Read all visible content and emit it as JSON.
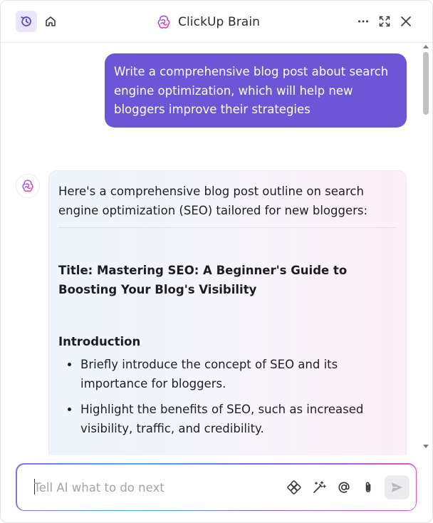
{
  "header": {
    "title": "ClickUp Brain",
    "icons": [
      "history-icon",
      "home-icon",
      "brain-logo-icon",
      "more-icon",
      "expand-icon",
      "close-icon"
    ],
    "accent": "#6c55d6"
  },
  "conversation": {
    "user_message": "Write a comprehensive blog post about search engine optimization, which will help new bloggers improve their strategies",
    "ai_intro": "Here's a comprehensive blog post outline on search engine optimization (SEO) tailored for new bloggers:",
    "ai_title": "Title: Mastering SEO: A Beginner's Guide to Boosting Your Blog's Visibility",
    "sections": [
      {
        "heading": "Introduction",
        "bullets": [
          "Briefly introduce the concept of SEO and its importance for bloggers.",
          "Highlight the benefits of SEO, such as increased visibility, traffic, and credibility."
        ]
      }
    ]
  },
  "composer": {
    "placeholder": "Tell AI what to do next",
    "value": "",
    "tools": [
      "skills-icon",
      "magic-wand-icon",
      "mention-icon",
      "attachment-icon",
      "send-icon"
    ]
  }
}
